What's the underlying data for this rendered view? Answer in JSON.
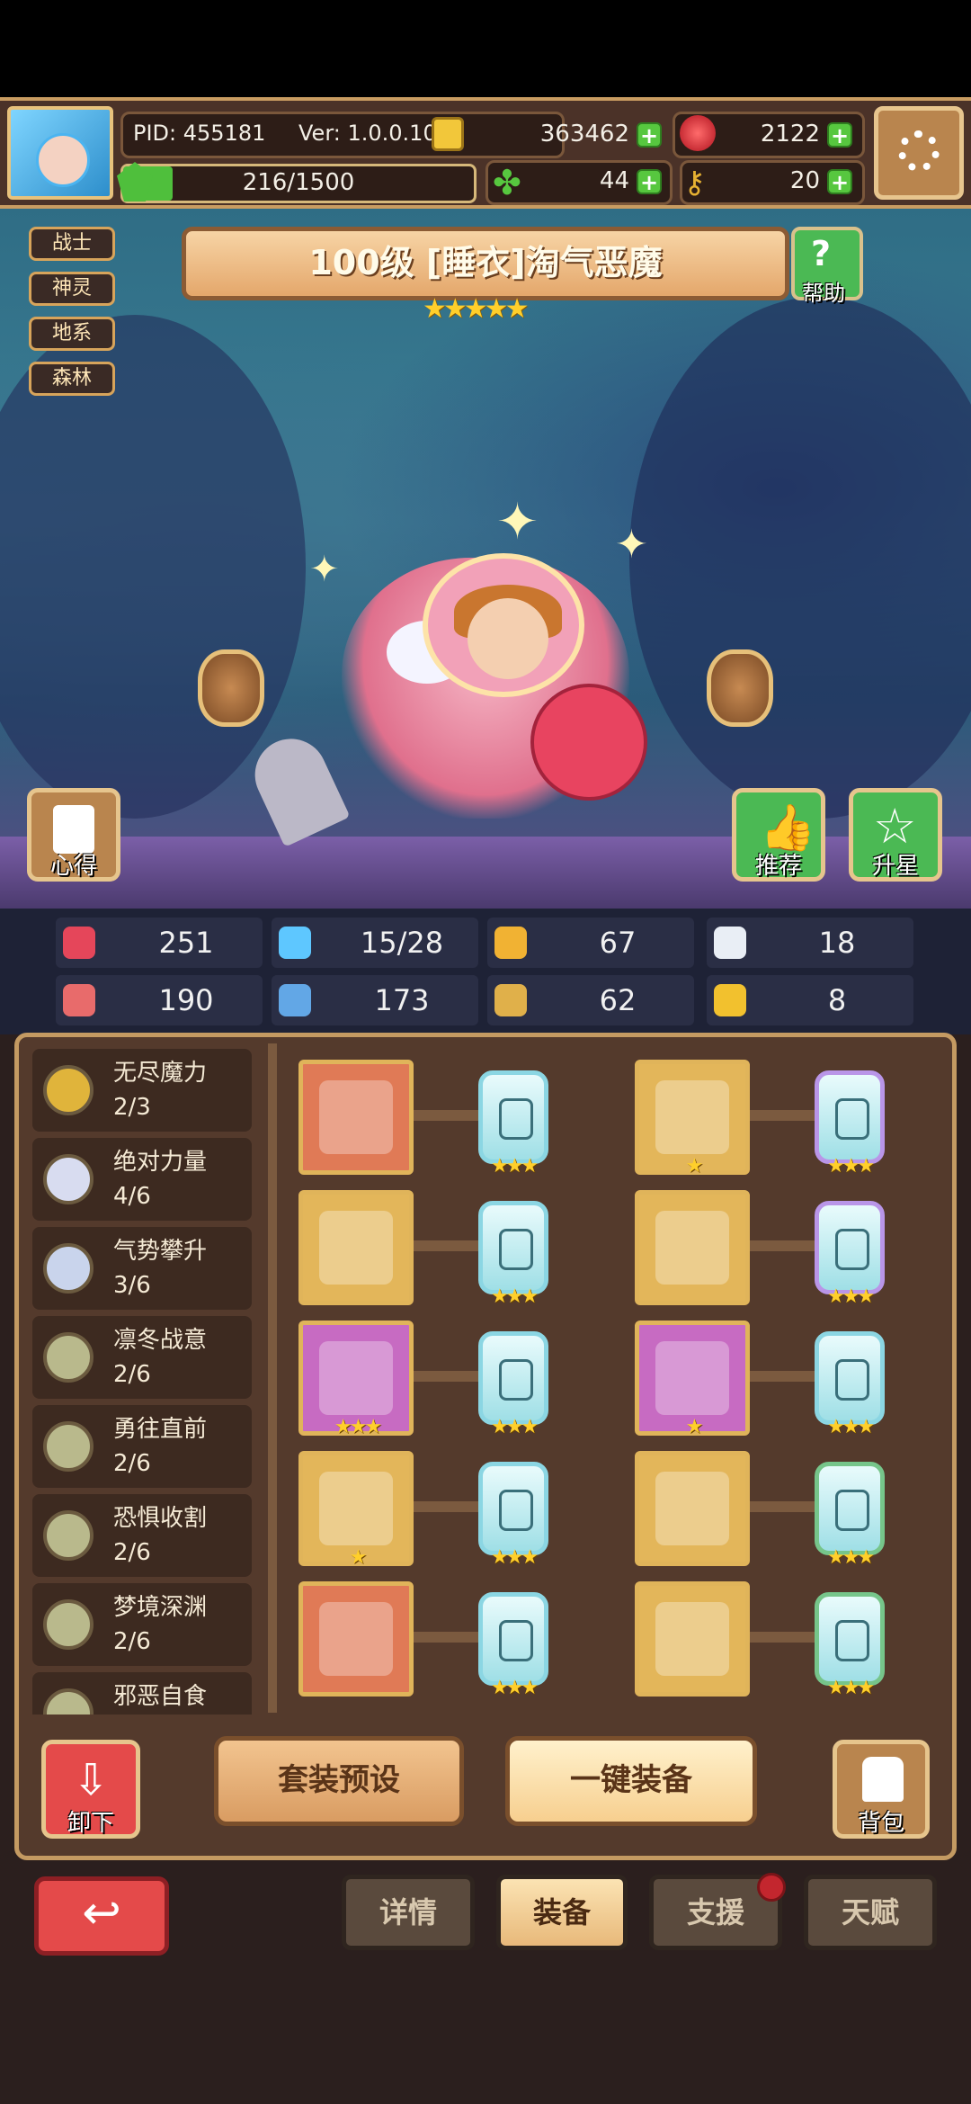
{
  "header": {
    "pid": "PID: 455181",
    "version": "Ver: 1.0.0.10",
    "gold": "363462",
    "gems": "2122",
    "exp": "216/1500",
    "clover": "44",
    "key": "20"
  },
  "character": {
    "tags": [
      "战士",
      "神灵",
      "地系",
      "森林"
    ],
    "title": "100级  [睡衣]淘气恶魔",
    "stars": "★★★★★",
    "help_label": "帮助",
    "insight_label": "心得",
    "recommend_label": "推荐",
    "star_up_label": "升星"
  },
  "stats": [
    {
      "icon": "heart-icon",
      "value": "251",
      "color": "#e5465a"
    },
    {
      "icon": "mana-drop-icon",
      "value": "15/28",
      "color": "#5ec7ff"
    },
    {
      "icon": "shield-icon",
      "value": "67",
      "color": "#f1b233"
    },
    {
      "icon": "wing-icon",
      "value": "18",
      "color": "#e9eef5"
    },
    {
      "icon": "fist-icon",
      "value": "190",
      "color": "#e86b6b"
    },
    {
      "icon": "book-icon",
      "value": "173",
      "color": "#62a7e6"
    },
    {
      "icon": "boots-icon",
      "value": "62",
      "color": "#e0b04a"
    },
    {
      "icon": "horseshoe-icon",
      "value": "8",
      "color": "#f2c12e"
    }
  ],
  "sets": [
    {
      "name": "无尽魔力",
      "count": "2/3",
      "color": "#e0b43b"
    },
    {
      "name": "绝对力量",
      "count": "4/6",
      "color": "#d8dcf0"
    },
    {
      "name": "气势攀升",
      "count": "3/6",
      "color": "#c9d4ec"
    },
    {
      "name": "凛冬战意",
      "count": "2/6",
      "color": "#b9b98c"
    },
    {
      "name": "勇往直前",
      "count": "2/6",
      "color": "#b9b98c"
    },
    {
      "name": "恐惧收割",
      "count": "2/6",
      "color": "#b9b98c"
    },
    {
      "name": "梦境深渊",
      "count": "2/6",
      "color": "#b9b98c"
    },
    {
      "name": "邪恶自食",
      "count": "",
      "color": "#b9b98c"
    }
  ],
  "equipment": [
    {
      "slot_bg": "#e07a56",
      "item": "sword-icon",
      "item_stars": "",
      "gem_stars": "★★★",
      "gem_border": "#8bd6e3"
    },
    {
      "slot_bg": "#e3b65a",
      "item": "amulet-icon",
      "item_stars": "★",
      "gem_stars": "★★★",
      "gem_border": "#b995e8"
    },
    {
      "slot_bg": "#e3b65a",
      "item": "armor-icon",
      "item_stars": "",
      "gem_stars": "★★★",
      "gem_border": "#8bd6e3"
    },
    {
      "slot_bg": "#e3b65a",
      "item": "robe-icon",
      "item_stars": "",
      "gem_stars": "★★★",
      "gem_border": "#b995e8"
    },
    {
      "slot_bg": "#c76bc2",
      "item": "necklace-icon",
      "item_stars": "★★★",
      "gem_stars": "★★★",
      "gem_border": "#8bd6e3"
    },
    {
      "slot_bg": "#c76bc2",
      "item": "glove-icon",
      "item_stars": "★",
      "gem_stars": "★★★",
      "gem_border": "#8bd6e3"
    },
    {
      "slot_bg": "#e3b65a",
      "item": "heart-orb-icon",
      "item_stars": "★",
      "gem_stars": "★★★",
      "gem_border": "#8bd6e3"
    },
    {
      "slot_bg": "#e3b65a",
      "item": "bowl-icon",
      "item_stars": "",
      "gem_stars": "★★★",
      "gem_border": "#76c58a"
    },
    {
      "slot_bg": "#e07a56",
      "item": "ring-icon",
      "item_stars": "",
      "gem_stars": "★★★",
      "gem_border": "#8bd6e3"
    },
    {
      "slot_bg": "#e3b65a",
      "item": "boots-item-icon",
      "item_stars": "",
      "gem_stars": "★★★",
      "gem_border": "#76c58a"
    }
  ],
  "actions": {
    "unequip": "卸下",
    "set_preset": "套装预设",
    "equip_all": "一键装备",
    "backpack": "背包"
  },
  "tabs": [
    "详情",
    "装备",
    "支援",
    "天赋"
  ],
  "active_tab": "装备"
}
